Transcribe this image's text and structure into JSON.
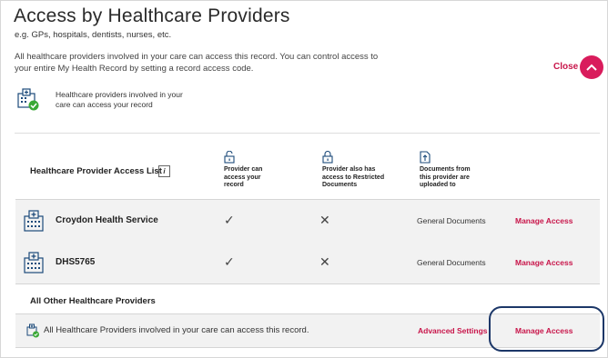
{
  "header": {
    "title": "Access by Healthcare Providers",
    "subtitle": "e.g. GPs, hospitals, dentists, nurses, etc.",
    "description": "All healthcare providers involved in your care can access this record. You can control access to your entire My Health Record by setting a record access code.",
    "close_label": "Close"
  },
  "summary": {
    "text": "Healthcare providers involved in your care can access your record"
  },
  "access_list": {
    "heading": "Healthcare Provider Access List",
    "info_icon_text": "i",
    "columns": [
      {
        "icon": "lock-open-icon",
        "label": "Provider can access your record"
      },
      {
        "icon": "lock-icon",
        "label": "Provider also has access to Restricted Documents"
      },
      {
        "icon": "document-upload-icon",
        "label": "Documents from this provider are uploaded to"
      }
    ],
    "rows": [
      {
        "name": "Croydon Health Service",
        "can_access": "✓",
        "restricted": "✕",
        "documents": "General Documents",
        "action": "Manage Access"
      },
      {
        "name": "DHS5765",
        "can_access": "✓",
        "restricted": "✕",
        "documents": "General Documents",
        "action": "Manage Access"
      }
    ]
  },
  "other_providers": {
    "heading": "All Other Healthcare Providers",
    "text": "All Healthcare Providers involved in your care can access this record.",
    "advanced_settings": "Advanced Settings",
    "action": "Manage Access"
  },
  "colors": {
    "accent": "#c8154a",
    "close_button": "#d91c5c",
    "highlight_outline": "#1c3768",
    "row_background": "#f2f2f2",
    "status_green": "#3aa935",
    "icon_blue": "#1c4a7a"
  }
}
